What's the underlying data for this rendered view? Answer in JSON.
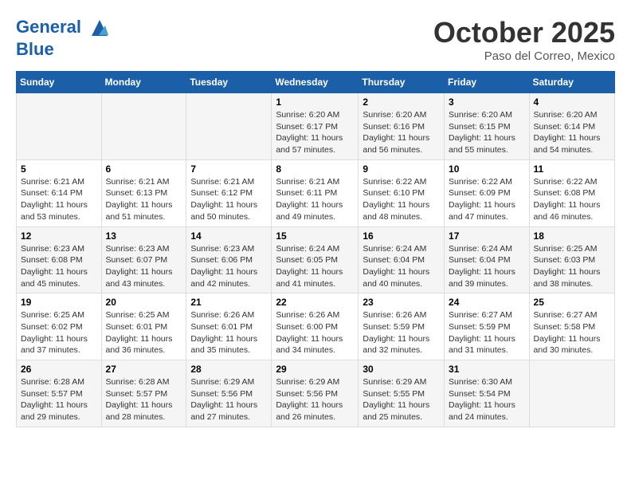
{
  "header": {
    "logo_line1": "General",
    "logo_line2": "Blue",
    "month": "October 2025",
    "location": "Paso del Correo, Mexico"
  },
  "weekdays": [
    "Sunday",
    "Monday",
    "Tuesday",
    "Wednesday",
    "Thursday",
    "Friday",
    "Saturday"
  ],
  "weeks": [
    [
      {
        "day": "",
        "info": ""
      },
      {
        "day": "",
        "info": ""
      },
      {
        "day": "",
        "info": ""
      },
      {
        "day": "1",
        "info": "Sunrise: 6:20 AM\nSunset: 6:17 PM\nDaylight: 11 hours and 57 minutes."
      },
      {
        "day": "2",
        "info": "Sunrise: 6:20 AM\nSunset: 6:16 PM\nDaylight: 11 hours and 56 minutes."
      },
      {
        "day": "3",
        "info": "Sunrise: 6:20 AM\nSunset: 6:15 PM\nDaylight: 11 hours and 55 minutes."
      },
      {
        "day": "4",
        "info": "Sunrise: 6:20 AM\nSunset: 6:14 PM\nDaylight: 11 hours and 54 minutes."
      }
    ],
    [
      {
        "day": "5",
        "info": "Sunrise: 6:21 AM\nSunset: 6:14 PM\nDaylight: 11 hours and 53 minutes."
      },
      {
        "day": "6",
        "info": "Sunrise: 6:21 AM\nSunset: 6:13 PM\nDaylight: 11 hours and 51 minutes."
      },
      {
        "day": "7",
        "info": "Sunrise: 6:21 AM\nSunset: 6:12 PM\nDaylight: 11 hours and 50 minutes."
      },
      {
        "day": "8",
        "info": "Sunrise: 6:21 AM\nSunset: 6:11 PM\nDaylight: 11 hours and 49 minutes."
      },
      {
        "day": "9",
        "info": "Sunrise: 6:22 AM\nSunset: 6:10 PM\nDaylight: 11 hours and 48 minutes."
      },
      {
        "day": "10",
        "info": "Sunrise: 6:22 AM\nSunset: 6:09 PM\nDaylight: 11 hours and 47 minutes."
      },
      {
        "day": "11",
        "info": "Sunrise: 6:22 AM\nSunset: 6:08 PM\nDaylight: 11 hours and 46 minutes."
      }
    ],
    [
      {
        "day": "12",
        "info": "Sunrise: 6:23 AM\nSunset: 6:08 PM\nDaylight: 11 hours and 45 minutes."
      },
      {
        "day": "13",
        "info": "Sunrise: 6:23 AM\nSunset: 6:07 PM\nDaylight: 11 hours and 43 minutes."
      },
      {
        "day": "14",
        "info": "Sunrise: 6:23 AM\nSunset: 6:06 PM\nDaylight: 11 hours and 42 minutes."
      },
      {
        "day": "15",
        "info": "Sunrise: 6:24 AM\nSunset: 6:05 PM\nDaylight: 11 hours and 41 minutes."
      },
      {
        "day": "16",
        "info": "Sunrise: 6:24 AM\nSunset: 6:04 PM\nDaylight: 11 hours and 40 minutes."
      },
      {
        "day": "17",
        "info": "Sunrise: 6:24 AM\nSunset: 6:04 PM\nDaylight: 11 hours and 39 minutes."
      },
      {
        "day": "18",
        "info": "Sunrise: 6:25 AM\nSunset: 6:03 PM\nDaylight: 11 hours and 38 minutes."
      }
    ],
    [
      {
        "day": "19",
        "info": "Sunrise: 6:25 AM\nSunset: 6:02 PM\nDaylight: 11 hours and 37 minutes."
      },
      {
        "day": "20",
        "info": "Sunrise: 6:25 AM\nSunset: 6:01 PM\nDaylight: 11 hours and 36 minutes."
      },
      {
        "day": "21",
        "info": "Sunrise: 6:26 AM\nSunset: 6:01 PM\nDaylight: 11 hours and 35 minutes."
      },
      {
        "day": "22",
        "info": "Sunrise: 6:26 AM\nSunset: 6:00 PM\nDaylight: 11 hours and 34 minutes."
      },
      {
        "day": "23",
        "info": "Sunrise: 6:26 AM\nSunset: 5:59 PM\nDaylight: 11 hours and 32 minutes."
      },
      {
        "day": "24",
        "info": "Sunrise: 6:27 AM\nSunset: 5:59 PM\nDaylight: 11 hours and 31 minutes."
      },
      {
        "day": "25",
        "info": "Sunrise: 6:27 AM\nSunset: 5:58 PM\nDaylight: 11 hours and 30 minutes."
      }
    ],
    [
      {
        "day": "26",
        "info": "Sunrise: 6:28 AM\nSunset: 5:57 PM\nDaylight: 11 hours and 29 minutes."
      },
      {
        "day": "27",
        "info": "Sunrise: 6:28 AM\nSunset: 5:57 PM\nDaylight: 11 hours and 28 minutes."
      },
      {
        "day": "28",
        "info": "Sunrise: 6:29 AM\nSunset: 5:56 PM\nDaylight: 11 hours and 27 minutes."
      },
      {
        "day": "29",
        "info": "Sunrise: 6:29 AM\nSunset: 5:56 PM\nDaylight: 11 hours and 26 minutes."
      },
      {
        "day": "30",
        "info": "Sunrise: 6:29 AM\nSunset: 5:55 PM\nDaylight: 11 hours and 25 minutes."
      },
      {
        "day": "31",
        "info": "Sunrise: 6:30 AM\nSunset: 5:54 PM\nDaylight: 11 hours and 24 minutes."
      },
      {
        "day": "",
        "info": ""
      }
    ]
  ]
}
